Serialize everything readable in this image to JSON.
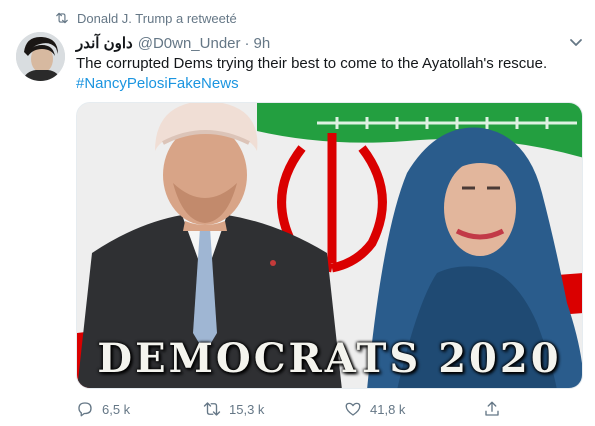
{
  "retweet_context": {
    "text": "Donald J. Trump a retweeté",
    "icon": "retweet-icon"
  },
  "tweet": {
    "display_name": "داون آندر",
    "handle": "@D0wn_Under",
    "separator": "·",
    "time": "9h",
    "text": "The corrupted Dems trying their best to come to the Ayatollah's rescue.",
    "hashtag": "#NancyPelosiFakeNews",
    "media": {
      "caption": "DEMOCRATS 2020"
    },
    "actions": {
      "replies": "6,5 k",
      "retweets": "15,3 k",
      "likes": "41,8 k"
    }
  },
  "colors": {
    "link": "#1b95e0",
    "secondary_text": "#657786",
    "flag_green": "#239f40",
    "flag_red": "#da0000"
  }
}
